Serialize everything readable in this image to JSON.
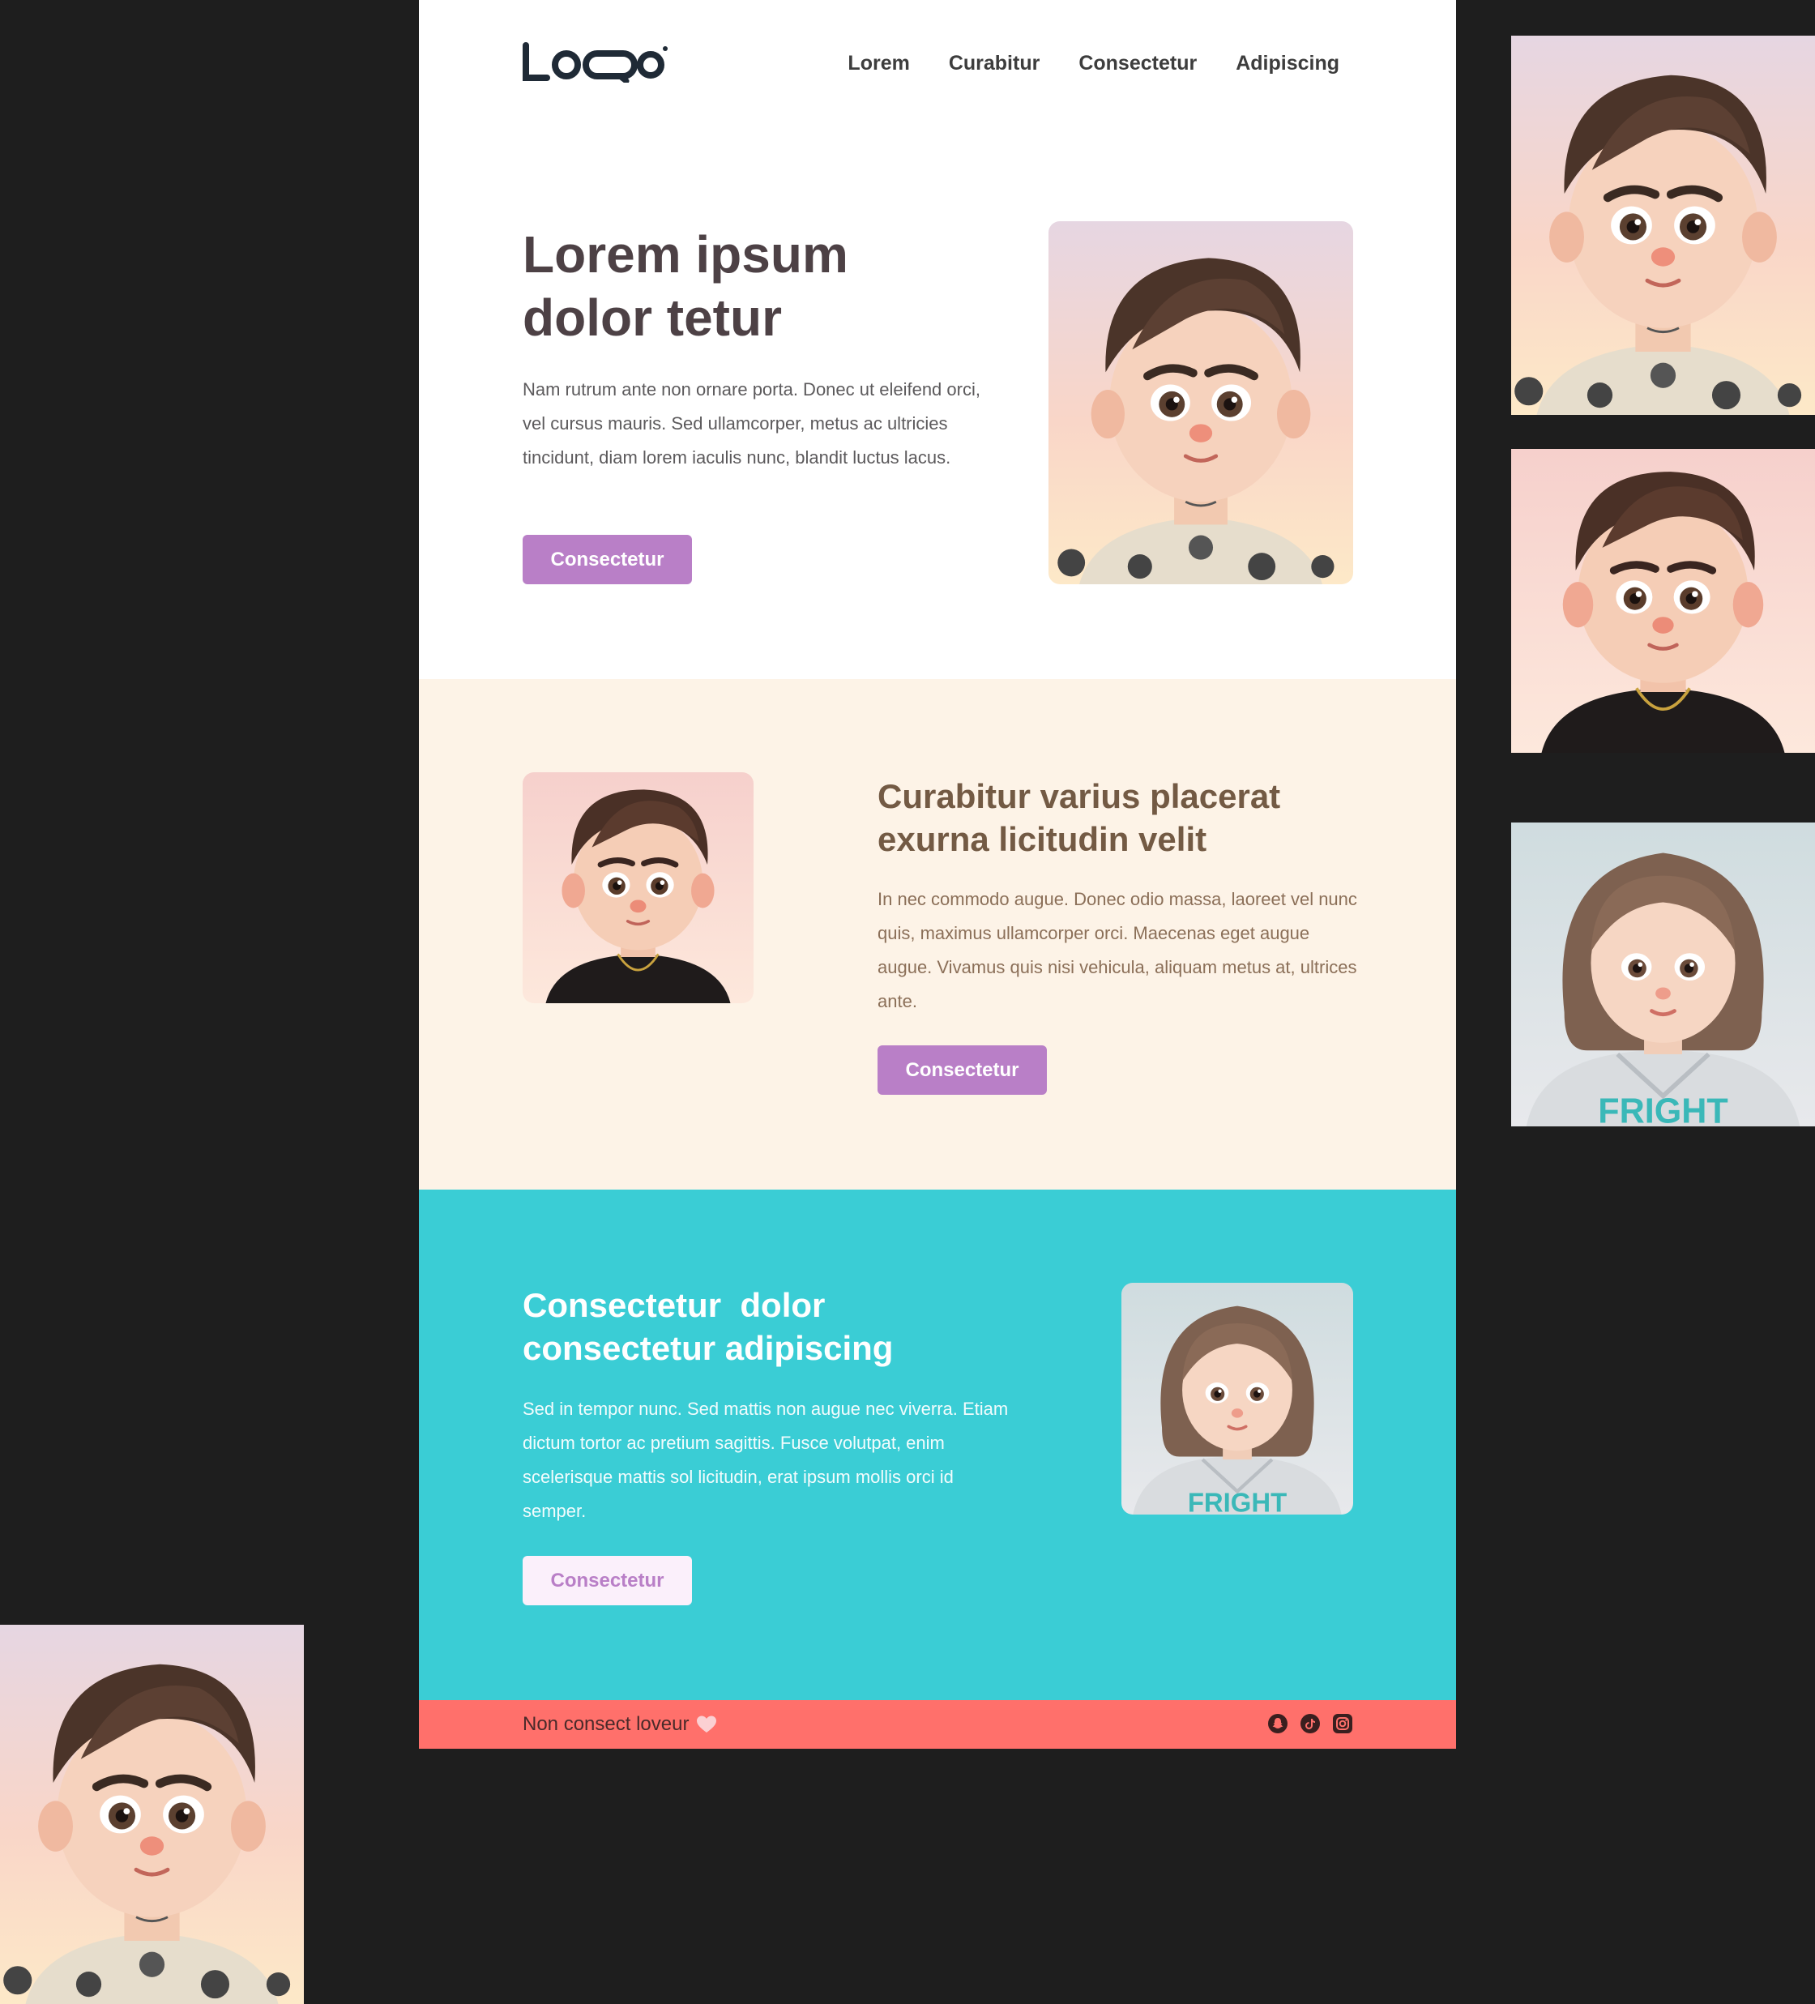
{
  "header": {
    "logo_alt": "Logo",
    "nav": [
      "Lorem",
      "Curabitur",
      "Consectetur",
      "Adipiscing"
    ]
  },
  "hero": {
    "title": "Lorem ipsum dolor tetur",
    "body": "Nam rutrum ante non ornare porta. Donec ut eleifend orci, vel cursus mauris. Sed ullamcorper, metus ac ultricies tincidunt, diam lorem iaculis nunc, blandit luctus lacus.",
    "button": "Consectetur",
    "image": "avatar-boy-tattoo"
  },
  "feature": {
    "title": "Curabitur varius placerat exurna licitudin velit",
    "body": "In nec commodo augue. Donec odio massa, laoreet vel nunc quis, maximus ullamcorper orci. Maecenas eget augue augue. Vivamus quis nisi vehicula, aliquam metus at, ultrices ante.",
    "button": "Consectetur",
    "image": "avatar-boy-chain"
  },
  "cta": {
    "title": "Consectetur  dolor consectetur adipiscing",
    "body": "Sed in tempor nunc. Sed mattis non augue nec viverra. Etiam dictum tortor ac pretium sagittis. Fusce volutpat, enim scelerisque mattis sol licitudin, erat ipsum mollis orci id semper.",
    "button": "Consectetur",
    "image": "avatar-girl-hoodie",
    "hoodie_text": "FRIGHT"
  },
  "footer": {
    "note": "Non consect loveur",
    "heart_icon": "heart-icon",
    "socials": [
      "snapchat-icon",
      "tiktok-icon",
      "instagram-icon"
    ]
  },
  "thumbnails": [
    "avatar-boy-tattoo",
    "avatar-boy-chain",
    "avatar-girl-hoodie",
    "avatar-boy-tattoo"
  ],
  "colors": {
    "background": "#1e1e1e",
    "button": "#b97fc7",
    "cream": "#fdf3e7",
    "teal": "#3acdd5",
    "footer": "#ff706b",
    "heading_dark": "#4d4145",
    "heading_brown": "#735a44"
  }
}
